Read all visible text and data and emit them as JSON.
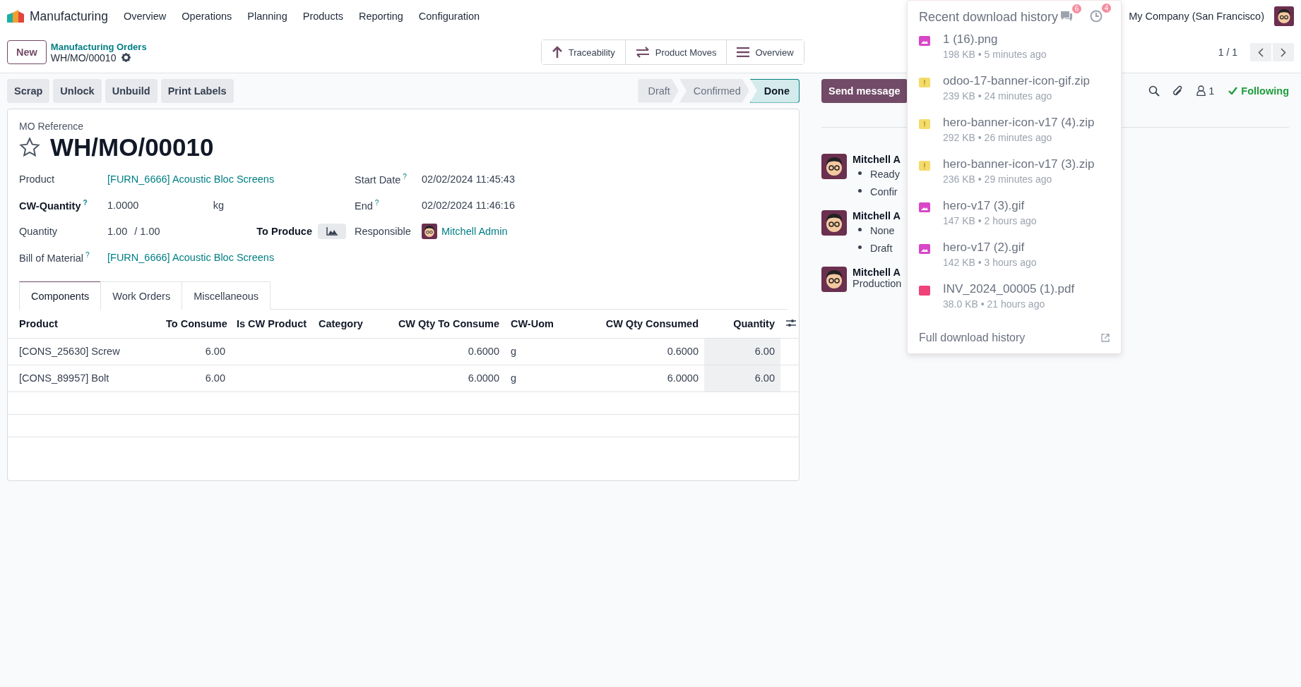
{
  "navbar": {
    "app": "Manufacturing",
    "menus": [
      "Overview",
      "Operations",
      "Planning",
      "Products",
      "Reporting",
      "Configuration"
    ],
    "messages_badge": "6",
    "activities_badge": "4",
    "company": "My Company (San Francisco)"
  },
  "control_panel": {
    "new_button": "New",
    "breadcrumb": "Manufacturing Orders",
    "record": "WH/MO/00010",
    "smart_buttons": [
      {
        "kind": "traceability",
        "label": "Traceability"
      },
      {
        "kind": "moves",
        "label": "Product Moves"
      },
      {
        "kind": "overview",
        "label": "Overview"
      }
    ],
    "pager": "1 / 1"
  },
  "actions": [
    "Scrap",
    "Unlock",
    "Unbuild",
    "Print Labels"
  ],
  "statusbar": [
    {
      "label": "Draft",
      "selected": false
    },
    {
      "label": "Confirmed",
      "selected": false
    },
    {
      "label": "Done",
      "selected": true
    }
  ],
  "form": {
    "reference_label": "MO Reference",
    "reference": "WH/MO/00010",
    "starred": false,
    "left_fields": [
      {
        "kind": "link",
        "label": "Product",
        "value": "[FURN_6666] Acoustic Bloc Screens"
      },
      {
        "kind": "cw",
        "label": "CW-Quantity",
        "help": "?",
        "value": "1.0000",
        "unit": "kg"
      },
      {
        "kind": "qty",
        "label": "Quantity",
        "value": "1.00",
        "total": "/ 1.00",
        "produce_label": "To Produce"
      },
      {
        "kind": "link",
        "label": "Bill of Material",
        "help": "?",
        "value": "[FURN_6666] Acoustic Bloc Screens"
      }
    ],
    "right_fields": [
      {
        "kind": "text",
        "label": "Start Date",
        "help": "?",
        "value": "02/02/2024 11:45:43"
      },
      {
        "kind": "text",
        "label": "End",
        "help": "?",
        "value": "02/02/2024 11:46:16"
      },
      {
        "kind": "user",
        "label": "Responsible",
        "value": "Mitchell Admin"
      }
    ],
    "tabs": [
      {
        "label": "Components",
        "selected": true
      },
      {
        "label": "Work Orders",
        "selected": false
      },
      {
        "label": "Miscellaneous",
        "selected": false
      }
    ],
    "table": {
      "columns": [
        "Product",
        "To Consume",
        "Is CW Product",
        "Category",
        "CW Qty To Consume",
        "CW-Uom",
        "CW Qty Consumed",
        "Quantity"
      ],
      "rows": [
        [
          "[CONS_25630] Screw",
          "6.00",
          "",
          "",
          "0.6000",
          "g",
          "0.6000",
          "6.00"
        ],
        [
          "[CONS_89957] Bolt",
          "6.00",
          "",
          "",
          "6.0000",
          "g",
          "6.0000",
          "6.00"
        ]
      ]
    }
  },
  "chatter": {
    "send": "Send message",
    "followers": "1",
    "following": "Following",
    "messages": [
      {
        "author": "Mitchell A",
        "changes": [
          "Ready",
          "Confir"
        ]
      },
      {
        "author": "Mitchell A",
        "changes": [
          "None",
          "Draft"
        ]
      },
      {
        "author": "Mitchell A",
        "body": "Production"
      }
    ]
  },
  "downloads": {
    "title": "Recent download history",
    "items": [
      {
        "kind": "image",
        "name": "1 (16).png",
        "meta": "198 KB • 5 minutes ago"
      },
      {
        "kind": "zip",
        "name": "odoo-17-banner-icon-gif.zip",
        "meta": "239 KB • 24 minutes ago"
      },
      {
        "kind": "zip",
        "name": "hero-banner-icon-v17 (4).zip",
        "meta": "292 KB • 26 minutes ago"
      },
      {
        "kind": "zip",
        "name": "hero-banner-icon-v17 (3).zip",
        "meta": "236 KB • 29 minutes ago"
      },
      {
        "kind": "image",
        "name": "hero-v17 (3).gif",
        "meta": "147 KB • 2 hours ago"
      },
      {
        "kind": "image",
        "name": "hero-v17 (2).gif",
        "meta": "142 KB • 3 hours ago"
      },
      {
        "kind": "pdf",
        "name": "INV_2024_00005 (1).pdf",
        "meta": "38.0 KB • 21 hours ago"
      }
    ],
    "footer": "Full download history"
  }
}
